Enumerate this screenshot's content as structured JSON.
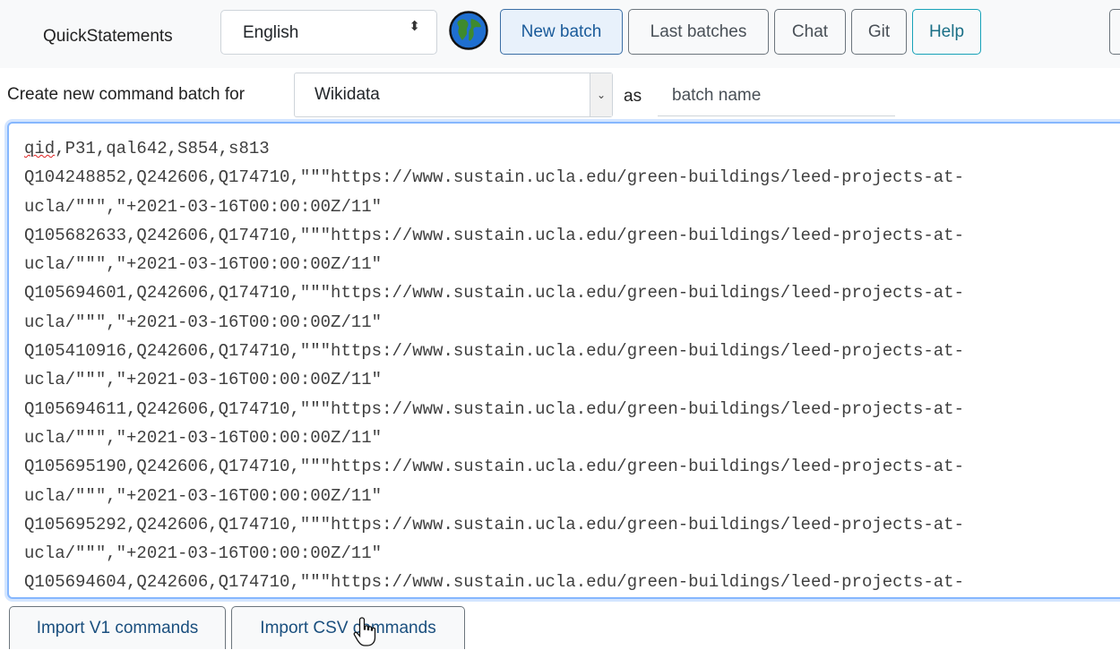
{
  "navbar": {
    "brand": "QuickStatements",
    "language": {
      "selected": "English",
      "arrow": "⬍"
    },
    "buttons": {
      "new_batch": "New batch",
      "last_batches": "Last batches",
      "chat": "Chat",
      "git": "Git",
      "help": "Help"
    }
  },
  "create_row": {
    "label": "Create new command batch for",
    "site": {
      "selected": "Wikidata",
      "arrow": "⌄"
    },
    "as_label": "as",
    "batch_name_placeholder": "batch name"
  },
  "commands": {
    "header_first": "qid",
    "header_rest": ",P31,qal642,S854,s813",
    "rows": [
      "Q104248852,Q242606,Q174710,\"\"\"https://www.sustain.ucla.edu/green-buildings/leed-projects-at-\nucla/\"\"\",\"+2021-03-16T00:00:00Z/11\"",
      "Q105682633,Q242606,Q174710,\"\"\"https://www.sustain.ucla.edu/green-buildings/leed-projects-at-\nucla/\"\"\",\"+2021-03-16T00:00:00Z/11\"",
      "Q105694601,Q242606,Q174710,\"\"\"https://www.sustain.ucla.edu/green-buildings/leed-projects-at-\nucla/\"\"\",\"+2021-03-16T00:00:00Z/11\"",
      "Q105410916,Q242606,Q174710,\"\"\"https://www.sustain.ucla.edu/green-buildings/leed-projects-at-\nucla/\"\"\",\"+2021-03-16T00:00:00Z/11\"",
      "Q105694611,Q242606,Q174710,\"\"\"https://www.sustain.ucla.edu/green-buildings/leed-projects-at-\nucla/\"\"\",\"+2021-03-16T00:00:00Z/11\"",
      "Q105695190,Q242606,Q174710,\"\"\"https://www.sustain.ucla.edu/green-buildings/leed-projects-at-\nucla/\"\"\",\"+2021-03-16T00:00:00Z/11\"",
      "Q105695292,Q242606,Q174710,\"\"\"https://www.sustain.ucla.edu/green-buildings/leed-projects-at-\nucla/\"\"\",\"+2021-03-16T00:00:00Z/11\"",
      "Q105694604,Q242606,Q174710,\"\"\"https://www.sustain.ucla.edu/green-buildings/leed-projects-at-"
    ]
  },
  "footer": {
    "import_v1": "Import V1 commands",
    "import_csv": "Import CSV commands"
  },
  "icons": {
    "globe": "globe-icon",
    "cursor": "hand-pointer-icon"
  },
  "colors": {
    "primary": "#1a5b9a",
    "info": "#17a2b8",
    "focus": "#86b7fe"
  }
}
